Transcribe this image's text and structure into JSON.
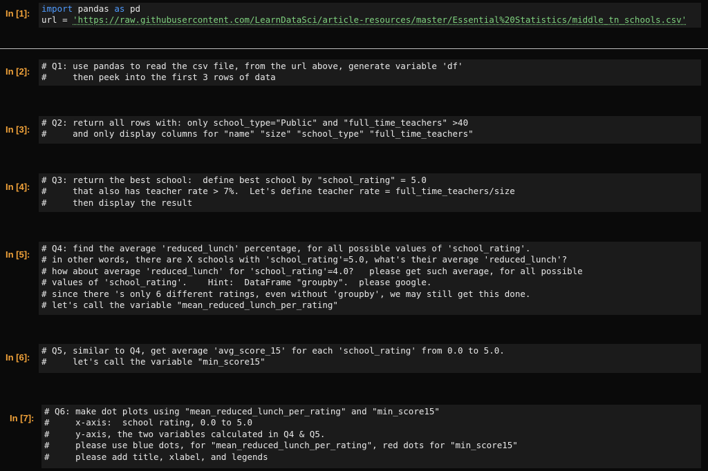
{
  "cells": [
    {
      "prompt": "In [1]:",
      "line1_kw1": "import",
      "line1_mod": " pandas ",
      "line1_kw2": "as",
      "line1_alias": " pd",
      "line2_pre": "url = ",
      "line2_url": "'https://raw.githubusercontent.com/LearnDataSci/article-resources/master/Essential%20Statistics/middle_tn_schools.csv'"
    },
    {
      "prompt": "In [2]:",
      "lines": [
        "# Q1: use pandas to read the csv file, from the url above, generate variable 'df'",
        "#     then peek into the first 3 rows of data"
      ]
    },
    {
      "prompt": "In [3]:",
      "lines": [
        "# Q2: return all rows with: only school_type=\"Public\" and \"full_time_teachers\" >40",
        "#     and only display columns for \"name\" \"size\" \"school_type\" \"full_time_teachers\""
      ]
    },
    {
      "prompt": "In [4]:",
      "lines": [
        "# Q3: return the best school:  define best school by \"school_rating\" = 5.0",
        "#     that also has teacher rate > 7%.  Let's define teacher rate = full_time_teachers/size",
        "#     then display the result"
      ]
    },
    {
      "prompt": "In [5]:",
      "lines": [
        "# Q4: find the average 'reduced_lunch' percentage, for all possible values of 'school_rating'.",
        "# in other words, there are X schools with 'school_rating'=5.0, what's their average 'reduced_lunch'?",
        "# how about average 'reduced_lunch' for 'school_rating'=4.0?   please get such average, for all possible",
        "# values of 'school_rating'.    Hint:  DataFrame \"groupby\".  please google.",
        "# since there 's only 6 different ratings, even without 'groupby', we may still get this done.",
        "# let's call the variable \"mean_reduced_lunch_per_rating\""
      ]
    },
    {
      "prompt": "In [6]:",
      "lines": [
        "# Q5, similar to Q4, get average 'avg_score_15' for each 'school_rating' from 0.0 to 5.0.",
        "#     let's call the variable \"min_score15\""
      ]
    },
    {
      "prompt": "In [7]:",
      "lines": [
        "# Q6: make dot plots using \"mean_reduced_lunch_per_rating\" and \"min_score15\"",
        "#     x-axis:  school rating, 0.0 to 5.0",
        "#     y-axis, the two variables calculated in Q4 & Q5.",
        "#     please use blue dots, for \"mean_reduced_lunch_per_rating\", red dots for \"min_score15\"",
        "#     please add title, xlabel, and legends"
      ]
    }
  ],
  "colors": {
    "prompt": "#f2a33a",
    "keyword": "#4f9bff",
    "string": "#7fd27f",
    "cell_bg": "#1b1b1b"
  }
}
